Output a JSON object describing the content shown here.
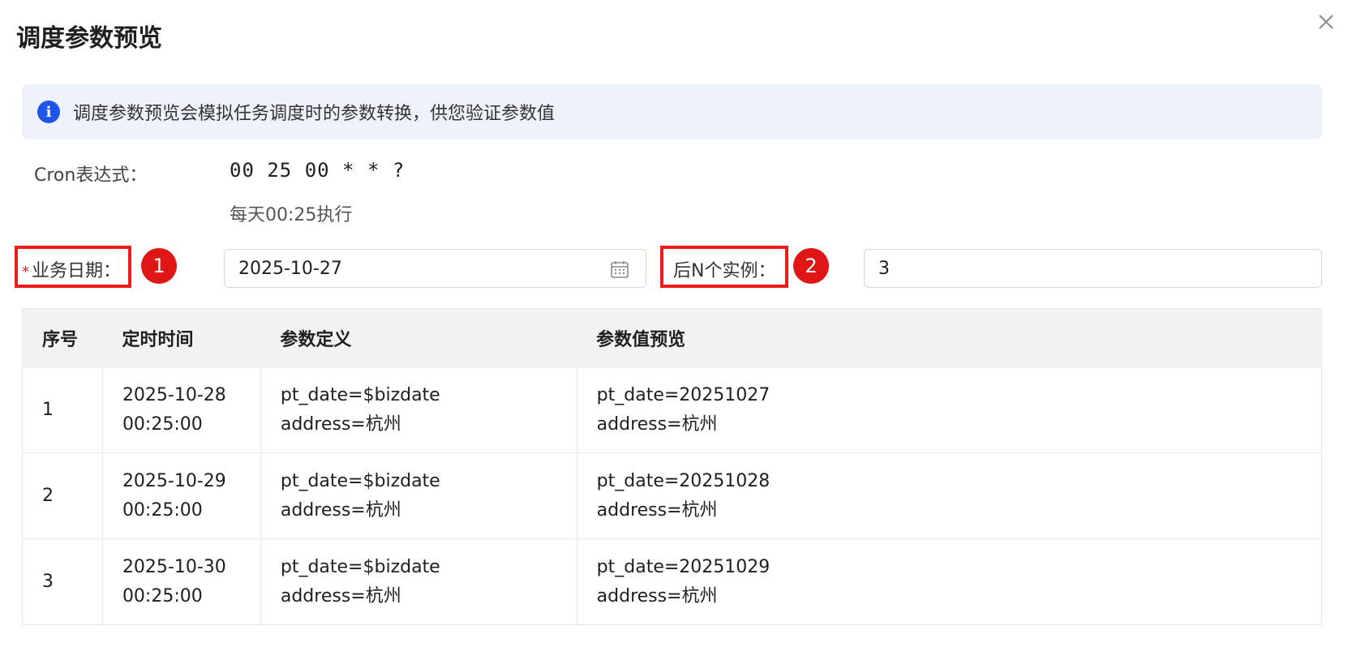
{
  "dialog": {
    "title": "调度参数预览",
    "close_icon": "close-icon"
  },
  "info": {
    "icon": "info-icon",
    "text": "调度参数预览会模拟任务调度时的参数转换，供您验证参数值"
  },
  "cron": {
    "label": "Cron表达式：",
    "value": "00 25 00 * * ?",
    "description": "每天00:25执行"
  },
  "form": {
    "biz_date": {
      "required_mark": "*",
      "label": "业务日期：",
      "value": "2025-10-27",
      "icon": "calendar-icon"
    },
    "instances": {
      "label": "后N个实例：",
      "value": "3"
    }
  },
  "annotations": {
    "marker1": "1",
    "marker2": "2",
    "color": "#e01515"
  },
  "table": {
    "headers": [
      "序号",
      "定时时间",
      "参数定义",
      "参数值预览"
    ],
    "rows": [
      {
        "index": "1",
        "time_date": "2025-10-28",
        "time_clock": "00:25:00",
        "def_line1": "pt_date=$bizdate",
        "def_line2": "address=杭州",
        "val_line1": "pt_date=20251027",
        "val_line2": "address=杭州"
      },
      {
        "index": "2",
        "time_date": "2025-10-29",
        "time_clock": "00:25:00",
        "def_line1": "pt_date=$bizdate",
        "def_line2": "address=杭州",
        "val_line1": "pt_date=20251028",
        "val_line2": "address=杭州"
      },
      {
        "index": "3",
        "time_date": "2025-10-30",
        "time_clock": "00:25:00",
        "def_line1": "pt_date=$bizdate",
        "def_line2": "address=杭州",
        "val_line1": "pt_date=20251029",
        "val_line2": "address=杭州"
      }
    ]
  },
  "colors": {
    "accent": "#1f55e8",
    "banner_bg": "#eef2fb",
    "header_bg": "#f2f2f2"
  }
}
